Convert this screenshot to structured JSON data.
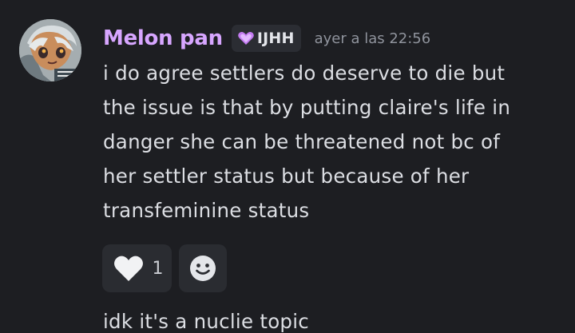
{
  "message": {
    "username": "Melon pan",
    "tag": {
      "icon": "purple-heart-icon",
      "text": "IJHH",
      "color": "#d7a6ff"
    },
    "timestamp": "ayer a las 22:56",
    "lines": [
      "i do agree settlers do deserve to die but",
      "the issue is that by putting claire's life in",
      "danger she can be threatened not bc of",
      "her settler status but because of her",
      "transfeminine status"
    ],
    "reactions": [
      {
        "icon": "white-heart-icon",
        "count": "1"
      },
      {
        "icon": "add-reaction-smiley-icon"
      }
    ]
  },
  "next_message": {
    "partial_text": "idk it's a nuclie topic"
  }
}
